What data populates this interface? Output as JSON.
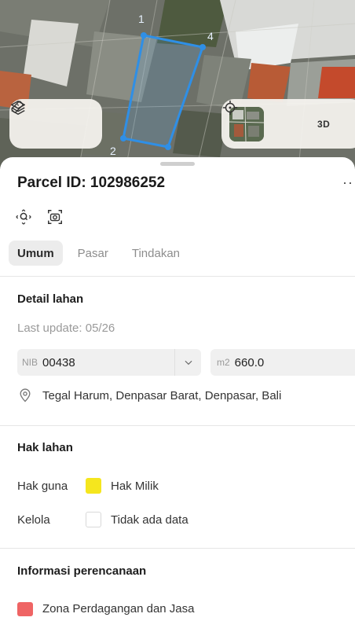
{
  "map": {
    "vertex_labels": [
      "1",
      "4",
      "2"
    ]
  },
  "map_controls": {
    "layers_icon": "layers-icon",
    "measure_icon": "measure-icon",
    "satellite_icon": "satellite-thumbnail",
    "locate_icon": "crosshair-icon",
    "three_d_label": "3D"
  },
  "parcel": {
    "title": "Parcel ID: 102986252",
    "more_label": "···"
  },
  "tabs": [
    {
      "label": "Umum",
      "active": true
    },
    {
      "label": "Pasar",
      "active": false
    },
    {
      "label": "Tindakan",
      "active": false
    }
  ],
  "detail": {
    "title": "Detail lahan",
    "last_update": "Last update: 05/26",
    "nib_prefix": "NIB",
    "nib_value": "00438",
    "area_prefix": "m2",
    "area_value": "660.0",
    "address": "Tegal Harum, Denpasar Barat, Denpasar, Bali"
  },
  "rights": {
    "title": "Hak lahan",
    "rows": [
      {
        "label": "Hak guna",
        "value": "Hak Milik",
        "color": "#f5e61e"
      },
      {
        "label": "Kelola",
        "value": "Tidak ada data",
        "color": "#ffffff"
      }
    ]
  },
  "planning": {
    "title": "Informasi perencanaan",
    "zone_label": "Zona Perdagangan dan Jasa",
    "zone_color": "#ef6464"
  },
  "colors": {
    "parcel_outline": "#2f8fe6"
  }
}
